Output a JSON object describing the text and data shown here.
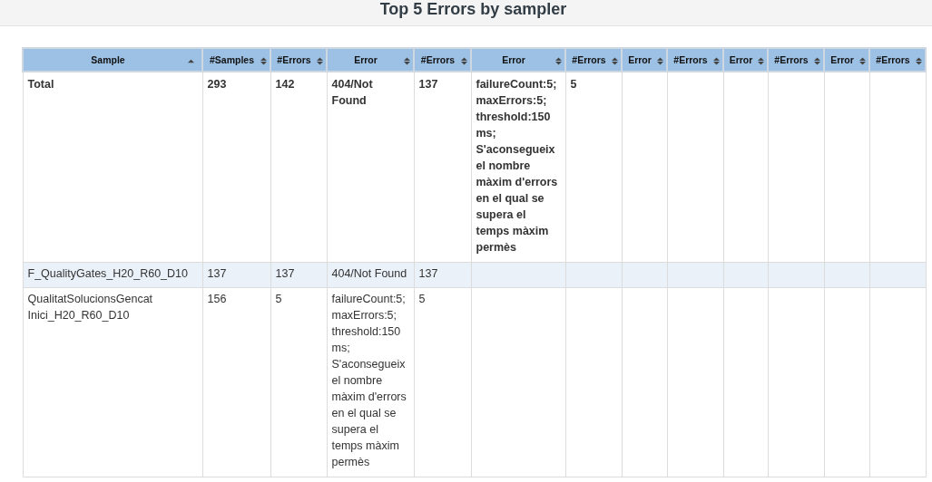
{
  "title": "Top 5 Errors by sampler",
  "table": {
    "columns": [
      {
        "label": "Sample",
        "sorted": true
      },
      {
        "label": "#Samples",
        "sorted": false
      },
      {
        "label": "#Errors",
        "sorted": false
      },
      {
        "label": "Error",
        "sorted": false
      },
      {
        "label": "#Errors",
        "sorted": false
      },
      {
        "label": "Error",
        "sorted": false
      },
      {
        "label": "#Errors",
        "sorted": false
      },
      {
        "label": "Error",
        "sorted": false
      },
      {
        "label": "#Errors",
        "sorted": false
      },
      {
        "label": "Error",
        "sorted": false
      },
      {
        "label": "#Errors",
        "sorted": false
      },
      {
        "label": "Error",
        "sorted": false
      },
      {
        "label": "#Errors",
        "sorted": false
      }
    ],
    "rows": [
      {
        "kind": "total",
        "cells": [
          "Total",
          "293",
          "142",
          "404/Not Found",
          "137",
          "failureCount:5; maxErrors:5; threshold:150 ms; S'aconsegueix el nombre màxim d'errors en el qual se supera el temps màxim permès",
          "5"
        ]
      },
      {
        "kind": "sample",
        "cells": [
          "F_QualityGates_H20_R60_D10",
          "137",
          "137",
          "404/Not Found",
          "137"
        ]
      },
      {
        "kind": "sample",
        "cells": [
          "QualitatSolucionsGencat Inici_H20_R60_D10",
          "156",
          "5",
          "failureCount:5; maxErrors:5; threshold:150 ms; S'aconsegueix el nombre màxim d'errors en el qual se supera el temps màxim permès",
          "5"
        ]
      }
    ]
  }
}
